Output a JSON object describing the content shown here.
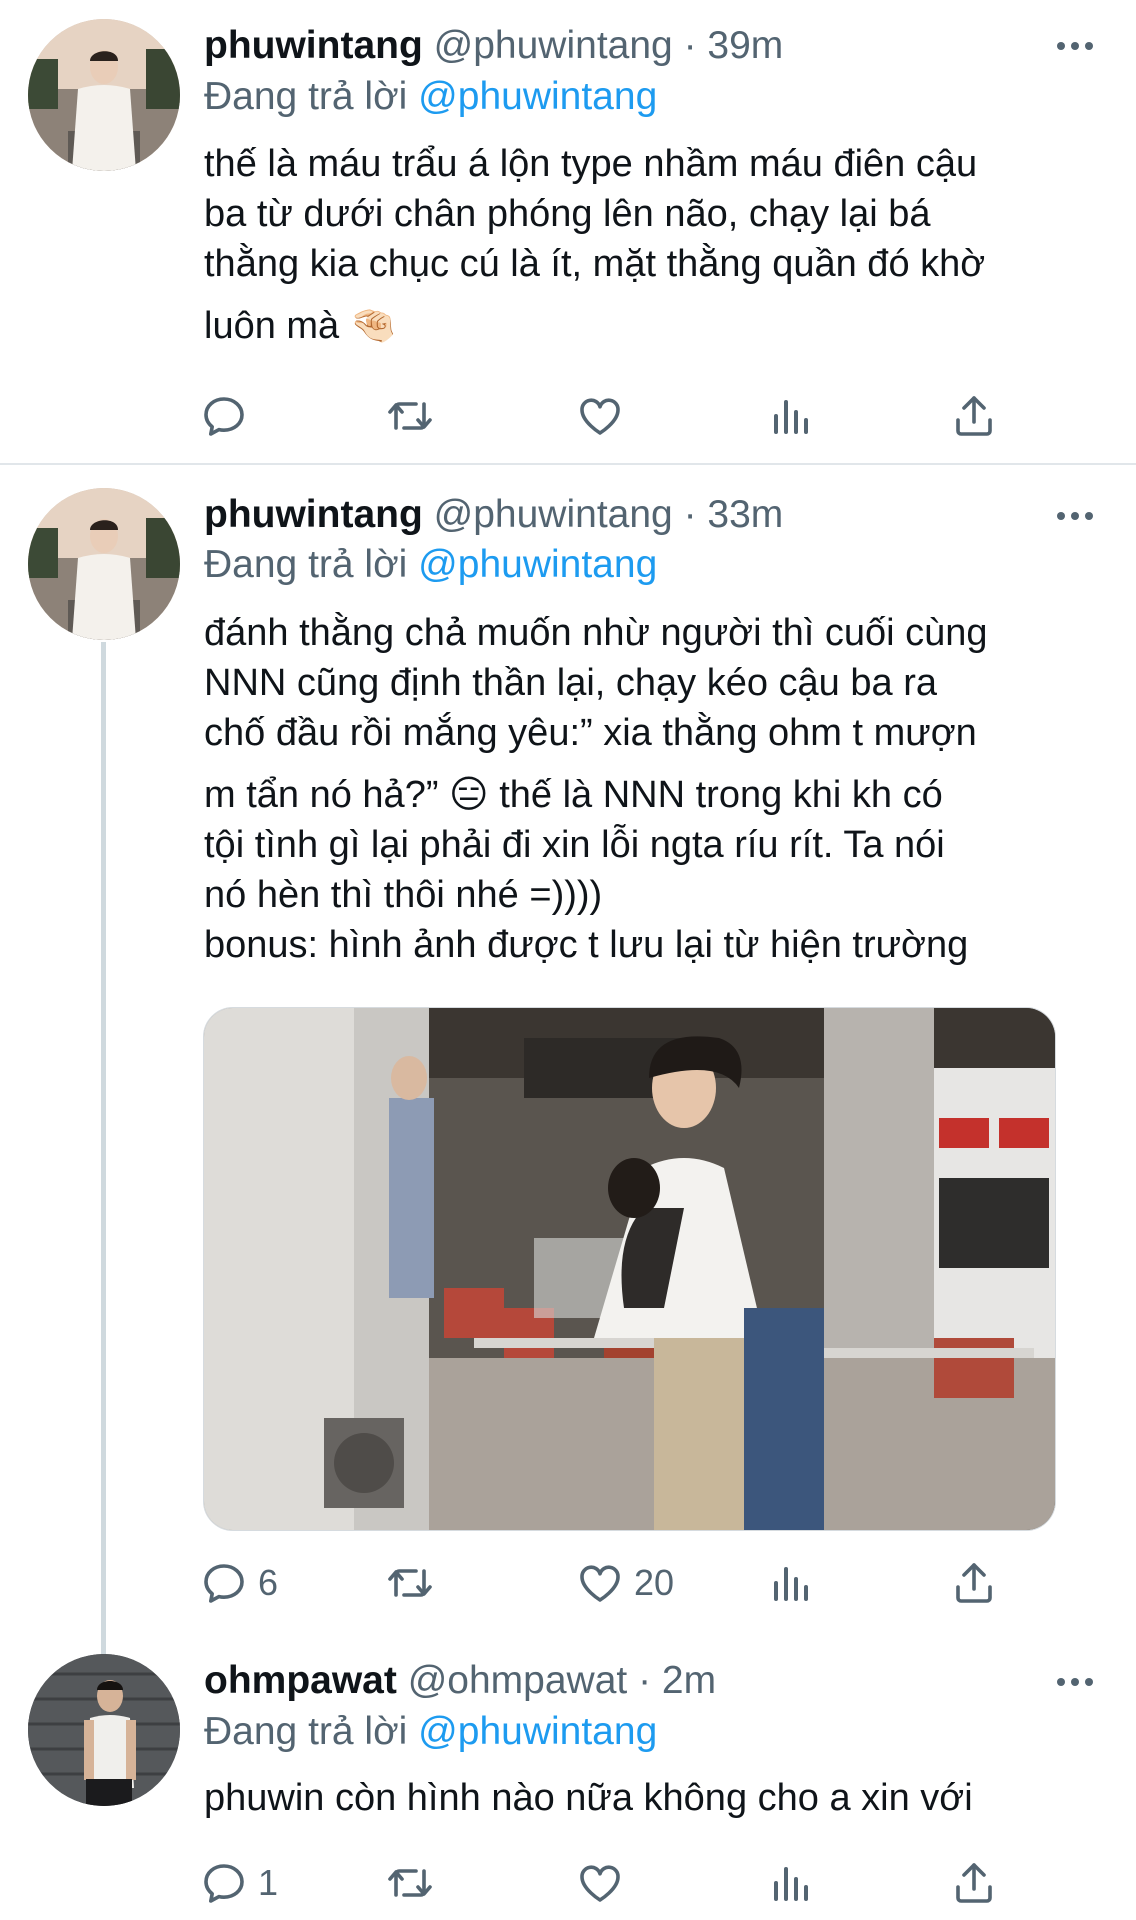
{
  "tweets": [
    {
      "name": "phuwintang",
      "handle": "@phuwintang",
      "dot": "·",
      "time": "39m",
      "reply_prefix": "Đang trả lời",
      "reply_to": "@phuwintang",
      "lines": [
        "thế là máu trẩu á lộn type nhầm máu điên cậu",
        "ba từ dưới chân phóng lên não, chạy lại bá",
        "thằng kia chục cú là ít, mặt thằng quần đó khờ",
        "luôn mà 🤏🏻"
      ],
      "actions": {
        "reply": "",
        "retweet": "",
        "like": ""
      }
    },
    {
      "name": "phuwintang",
      "handle": "@phuwintang",
      "dot": "·",
      "time": "33m",
      "reply_prefix": "Đang trả lời",
      "reply_to": "@phuwintang",
      "lines": [
        "đánh thằng chả muốn nhừ người thì cuối cùng",
        "NNN cũng định thần lại, chạy kéo cậu ba ra",
        "chố đầu rồi mắng yêu:” xia thằng ohm t mượn",
        "m tẩn nó hả?” 😑  thế là NNN trong khi kh có",
        "tội tình gì lại phải đi xin lỗi ngta ríu rít. Ta nói",
        "nó hèn thì thôi nhé =))))",
        "bonus: hình ảnh được t lưu lại từ hiện trường"
      ],
      "actions": {
        "reply": "6",
        "retweet": "",
        "like": "20"
      }
    },
    {
      "name": "ohmpawat",
      "handle": "@ohmpawat",
      "dot": "·",
      "time": "2m",
      "reply_prefix": "Đang trả lời",
      "reply_to": "@phuwintang",
      "lines": [
        "phuwin còn hình nào nữa không cho a xin với"
      ],
      "actions": {
        "reply": "1",
        "retweet": "",
        "like": ""
      }
    }
  ],
  "icons": {
    "reply": "reply-icon",
    "retweet": "retweet-icon",
    "like": "like-icon",
    "views": "views-icon",
    "share": "share-icon",
    "more": "more-icon"
  },
  "colors": {
    "link": "#1d9bf0",
    "secondary": "#536471",
    "text": "#0f1419",
    "thread_line": "#cfd9de"
  }
}
